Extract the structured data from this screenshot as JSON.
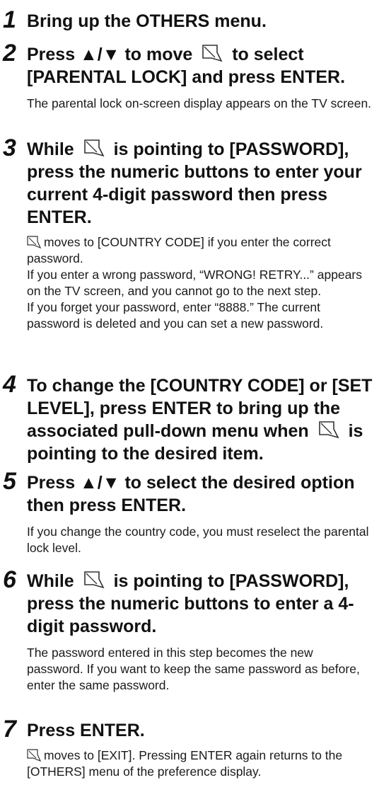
{
  "steps": [
    {
      "number": "1",
      "heading": "Bring up the OTHERS menu."
    },
    {
      "number": "2",
      "heading_pre": "Press ▲/▼ to move",
      "heading_post": "to select",
      "heading_line2": "[PARENTAL LOCK] and press ENTER.",
      "body": "The parental lock on-screen display appears on the TV screen."
    },
    {
      "number": "3",
      "heading_pre": "While",
      "heading_post": "is pointing to [PASSWORD],",
      "heading_rest": "press the numeric buttons to enter your current 4-digit password then press ENTER.",
      "body_first": "moves to [COUNTRY CODE] if you enter the correct password.",
      "body_p2": "If you enter a wrong password, “WRONG! RETRY...” appears on the TV screen, and you cannot go to the next step.",
      "body_p3": "If you forget your password, enter “8888.” The current password is deleted and you can set a new password."
    },
    {
      "number": "4",
      "heading_pre": "To change the [COUNTRY CODE] or [SET LEVEL], press ENTER to bring up the associated pull-down menu when",
      "heading_post": "is pointing to the desired item."
    },
    {
      "number": "5",
      "heading": "Press ▲/▼ to select the desired option then press ENTER.",
      "body": "If you change the country code, you must reselect the parental lock level."
    },
    {
      "number": "6",
      "heading_pre": "While",
      "heading_post": "is pointing to [PASSWORD],",
      "heading_rest": "press the numeric buttons to enter a 4-digit password.",
      "body": "The password entered in this step becomes the new password. If you want to keep the same password as before, enter the same password."
    },
    {
      "number": "7",
      "heading": "Press ENTER.",
      "body_first": "moves to [EXIT]. Pressing ENTER again returns to the [OTHERS] menu of the preference display."
    }
  ],
  "icons": {
    "cursor": "cursor-arrow-icon"
  }
}
